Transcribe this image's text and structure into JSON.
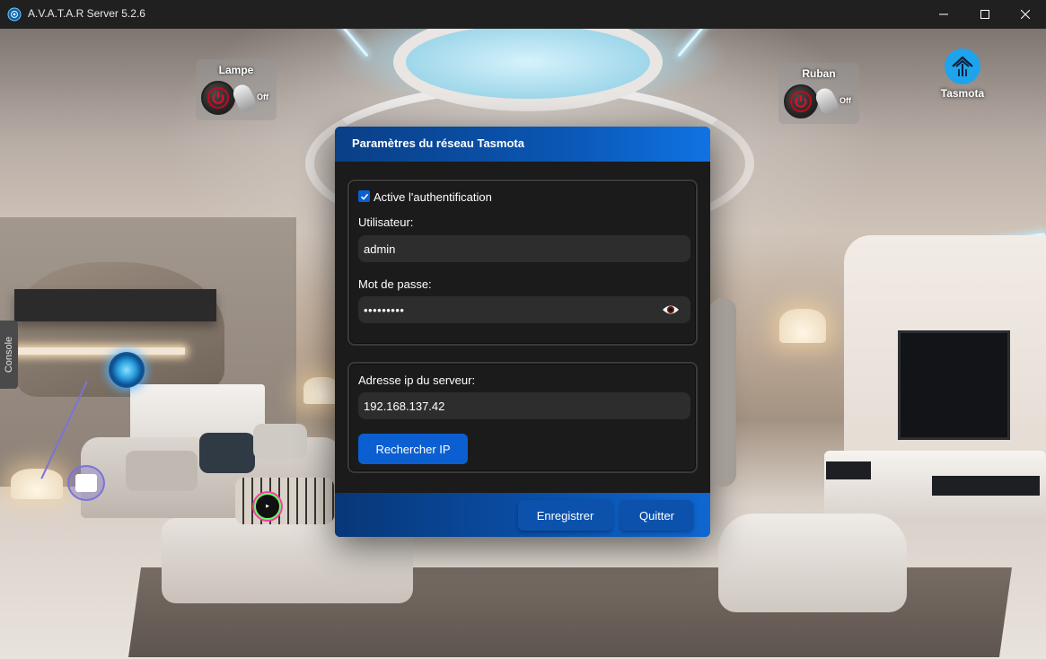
{
  "window": {
    "title": "A.V.A.T.A.R Server 5.2.6",
    "icon": "avatar-logo-icon"
  },
  "console_tab": {
    "label": "Console"
  },
  "widgets": {
    "lampe": {
      "title": "Lampe",
      "state": "Off"
    },
    "ruban": {
      "title": "Ruban",
      "state": "Off"
    },
    "tasmota": {
      "label": "Tasmota",
      "icon": "tasmota-home-icon",
      "color": "#1fa3ec"
    }
  },
  "dialog": {
    "title": "Paramètres du réseau Tasmota",
    "auth": {
      "checkbox_label": "Active l'authentification",
      "checked": true,
      "user_label": "Utilisateur:",
      "user_value": "admin",
      "password_label": "Mot de passe:",
      "password_value": "•••••••••"
    },
    "server": {
      "ip_label": "Adresse ip du serveur:",
      "ip_value": "192.168.137.42",
      "search_button": "Rechercher IP"
    },
    "footer": {
      "save_button": "Enregistrer",
      "quit_button": "Quitter"
    },
    "colors": {
      "accent": "#0b5fd1",
      "header": "#0a56b3",
      "background": "#1b1b1b",
      "field": "#2d2d2d"
    }
  }
}
